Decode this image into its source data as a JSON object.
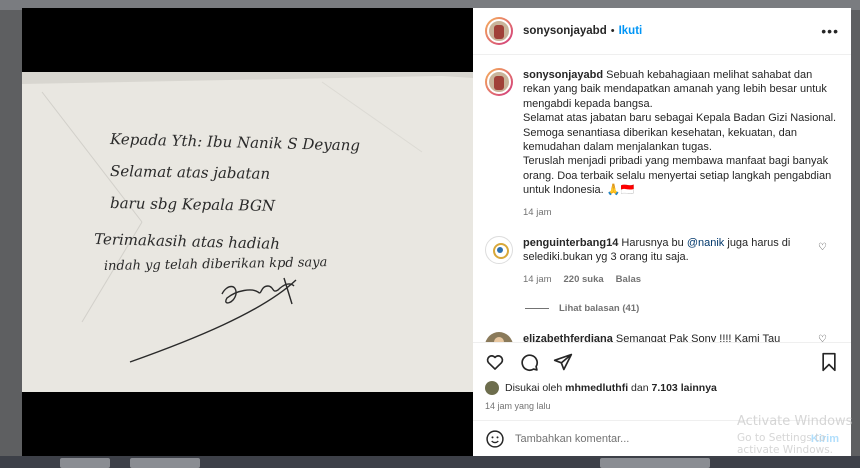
{
  "header": {
    "username": "sonysonjayabd",
    "separator": "•",
    "follow_label": "Ikuti",
    "more_label": "•••"
  },
  "caption": {
    "username": "sonysonjayabd",
    "p1": "Sebuah kebahagiaan melihat sahabat dan rekan yang baik mendapatkan amanah yang lebih besar untuk mengabdi kepada bangsa.",
    "p2": "Selamat atas jabatan baru sebagai Kepala Badan Gizi Nasional.",
    "p3": "Semoga senantiasa diberikan kesehatan, kekuatan, dan kemudahan dalam menjalankan tugas.",
    "p4": "Teruslah menjadi pribadi yang membawa manfaat bagi banyak orang. Doa terbaik selalu menyertai setiap langkah pengabdian untuk Indonesia. 🙏🇮🇩",
    "time": "14 jam"
  },
  "comments": [
    {
      "username": "penguinterbang14",
      "text_before": "Harusnya bu",
      "mention": "@nanik",
      "text_after": "juga harus di selediki.bukan yg 3 orang itu saja.",
      "time": "14 jam",
      "likes": "220 suka",
      "reply": "Balas",
      "view_replies": "Lihat balasan (41)"
    },
    {
      "username": "elizabethferdiana",
      "text": "Semangat Pak Sony !!!! Kami Tau perjuangan"
    }
  ],
  "likes_line": {
    "prefix": "Disukai oleh",
    "user": "mhmedluthfi",
    "connector": "dan",
    "others": "7.103 lainnya"
  },
  "post_time": "14 jam yang lalu",
  "add_comment": {
    "placeholder": "Tambahkan komentar...",
    "post_label": "Kirim"
  },
  "handwriting": {
    "line1": "Kepada Yth: Ibu Nanik S Deyang",
    "line2": "Selamat atas jabatan",
    "line3": "baru sbg Kepala BGN",
    "line4": "Terimakasih atas hadiah",
    "line5": "indah yg telah diberikan kpd saya"
  },
  "watermark": {
    "line1": "Activate Windows",
    "line2": "Go to Settings to activate Windows."
  },
  "icons": [
    "heart-icon",
    "comment-icon",
    "share-icon",
    "bookmark-icon",
    "emoji-icon",
    "more-icon"
  ],
  "colors": {
    "follow": "#0095f6",
    "mention": "#00376b",
    "ink": "#2a2a2a",
    "paper": "#e9e7e1"
  }
}
